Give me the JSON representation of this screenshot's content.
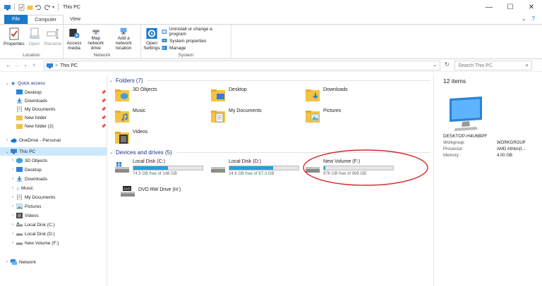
{
  "window": {
    "title": "This PC",
    "controls": {
      "minimize": "—",
      "maximize": "☐",
      "close": "✕"
    }
  },
  "tabs": [
    {
      "label": "File"
    },
    {
      "label": "Computer"
    },
    {
      "label": "View"
    }
  ],
  "tab_right": {
    "chevron": "⌄",
    "help": "?"
  },
  "ribbon": {
    "location": {
      "label": "Location",
      "properties": "Properties",
      "open": "Open",
      "rename": "Rename"
    },
    "network": {
      "label": "Network",
      "access_media": "Access media",
      "map_network_drive": "Map network drive",
      "add_network_location": "Add a network location"
    },
    "system": {
      "label": "System",
      "open_settings": "Open Settings",
      "uninstall": "Uninstall or change a program",
      "system_properties": "System properties",
      "manage": "Manage"
    }
  },
  "address": {
    "back": "←",
    "forward": "→",
    "recent": "⌄",
    "up": "↑",
    "path": "This PC",
    "separator": ">",
    "search_placeholder": "Search This PC"
  },
  "nav": {
    "quick_access": "Quick access",
    "quick_items": [
      "Desktop",
      "Downloads",
      "My Documents",
      "New folder",
      "New folder (2)"
    ],
    "onedrive": "OneDrive - Personal",
    "this_pc": "This PC",
    "pc_items": [
      "3D Objects",
      "Desktop",
      "Downloads",
      "Music",
      "My Documents",
      "Pictures",
      "Videos",
      "Local Disk (C:)",
      "Local Disk (D:)",
      "New Volume (F:)"
    ],
    "network": "Network"
  },
  "content": {
    "folders_header": "Folders (7)",
    "folders": [
      "3D Objects",
      "Desktop",
      "Downloads",
      "Music",
      "My Documents",
      "Pictures",
      "Videos"
    ],
    "drives_header": "Devices and drives (5)",
    "drives": [
      {
        "name": "Local Disk (C:)",
        "free": "74.5 GB free of 148 GB",
        "used_fraction": 0.5
      },
      {
        "name": "Local Disk (D:)",
        "free": "24.6 GB free of 67.3 GB",
        "used_fraction": 0.63
      },
      {
        "name": "New Volume (F:)",
        "free": "976 GB free of 999 GB",
        "used_fraction": 0.02
      },
      {
        "name": "DVD RW Drive (H:)"
      }
    ],
    "annotation_color": "#d9262c"
  },
  "details": {
    "count": "12 items",
    "computer_name": "DESKTOP-H4U6BPF",
    "rows": [
      {
        "key": "Workgroup:",
        "value": "WORKGROUP"
      },
      {
        "key": "Processor:",
        "value": "AMD Athlon(t..."
      },
      {
        "key": "Memory:",
        "value": "4.00 GB"
      }
    ]
  },
  "colors": {
    "accent": "#1979ca",
    "selection": "#cce8ff",
    "folder": "#f5c242",
    "drive_bar": "#26a0da"
  }
}
